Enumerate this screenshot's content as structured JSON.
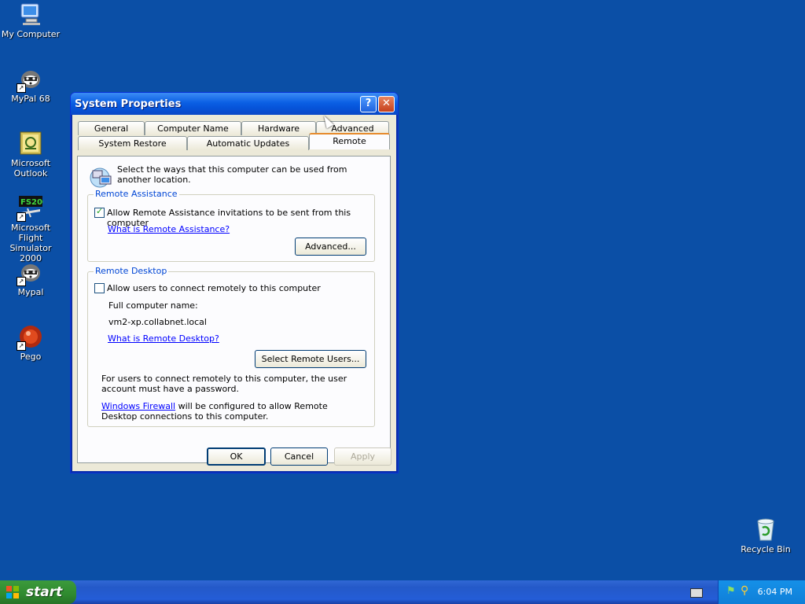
{
  "desktop": {
    "icons": [
      {
        "label": "My Computer"
      },
      {
        "label": "MyPal 68"
      },
      {
        "label": "Microsoft Outlook"
      },
      {
        "label": "Microsoft Flight Simulator 2000"
      },
      {
        "label": "Mypal"
      },
      {
        "label": "Pego"
      },
      {
        "label": "Recycle Bin"
      }
    ]
  },
  "window": {
    "title": "System Properties",
    "tabs_row1": [
      "General",
      "Computer Name",
      "Hardware",
      "Advanced"
    ],
    "tabs_row2": [
      "System Restore",
      "Automatic Updates",
      "Remote"
    ],
    "active_tab": "Remote",
    "intro": "Select the ways that this computer can be used from another location.",
    "remote_assistance": {
      "title": "Remote Assistance",
      "checkbox_label": "Allow Remote Assistance invitations to be sent from this computer",
      "checked": true,
      "link": "What is Remote Assistance?",
      "advanced_button": "Advanced..."
    },
    "remote_desktop": {
      "title": "Remote Desktop",
      "checkbox_label": "Allow users to connect remotely to this computer",
      "checked": false,
      "full_name_label": "Full computer name:",
      "full_name_value": "vm2-xp.collabnet.local",
      "link": "What is Remote Desktop?",
      "select_users_button": "Select Remote Users...",
      "password_note": "For users to connect remotely to this computer, the user account must have a password.",
      "firewall_link": "Windows Firewall",
      "firewall_note": " will be configured to allow Remote Desktop connections to this computer."
    },
    "buttons": {
      "ok": "OK",
      "cancel": "Cancel",
      "apply": "Apply"
    }
  },
  "taskbar": {
    "start_label": "start",
    "time": "6:04 PM"
  },
  "colors": {
    "desktop": "#0b4fa6",
    "titlebar": "#0a5fe4",
    "link": "#0000ff",
    "group_title": "#0046d5"
  }
}
